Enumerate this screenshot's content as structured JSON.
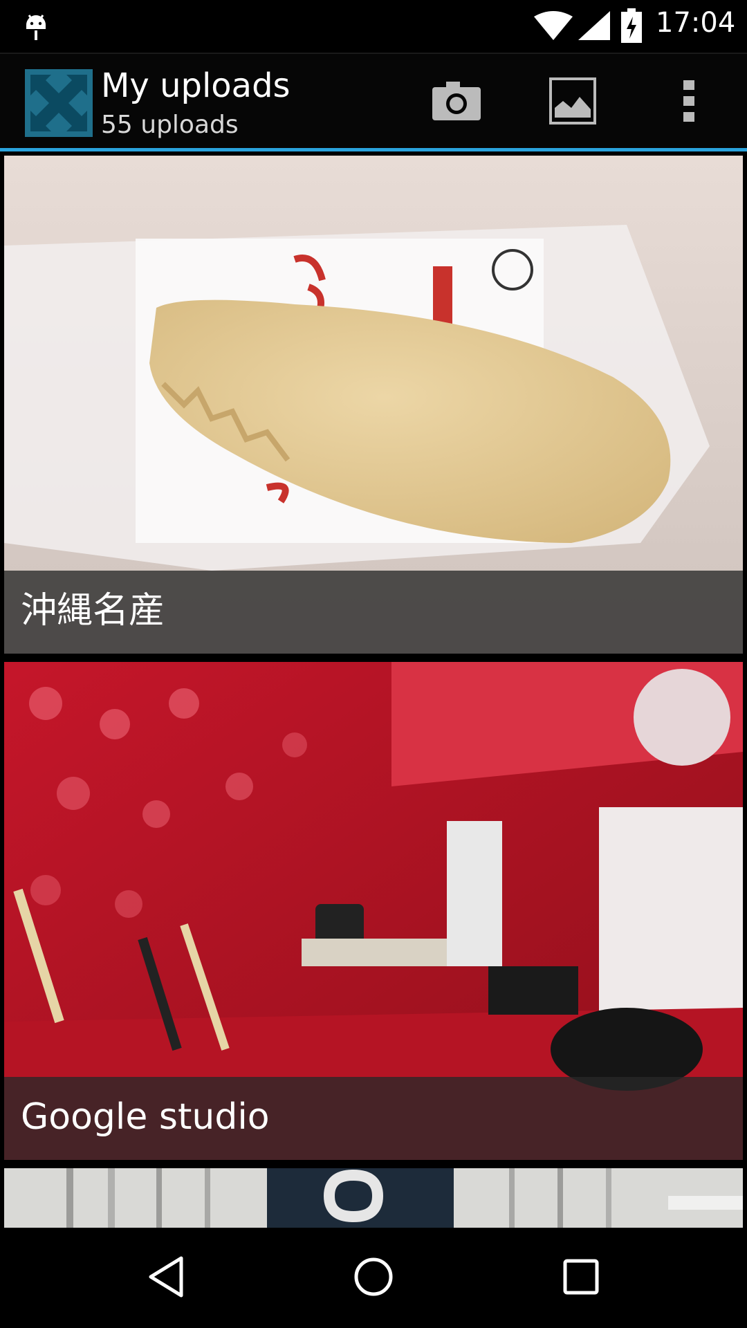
{
  "status_bar": {
    "time": "17:04",
    "icons": [
      "android-icon",
      "wifi-icon",
      "signal-icon",
      "battery-charging-icon"
    ]
  },
  "action_bar": {
    "title": "My uploads",
    "subtitle": "55 uploads",
    "actions": [
      "camera-icon",
      "gallery-icon",
      "overflow-menu-icon"
    ],
    "accent_color": "#2aa3dd"
  },
  "uploads": [
    {
      "caption": "沖縄名産"
    },
    {
      "caption": "Google studio"
    }
  ],
  "nav_bar": {
    "icons": [
      "back-icon",
      "home-icon",
      "recents-icon"
    ]
  }
}
